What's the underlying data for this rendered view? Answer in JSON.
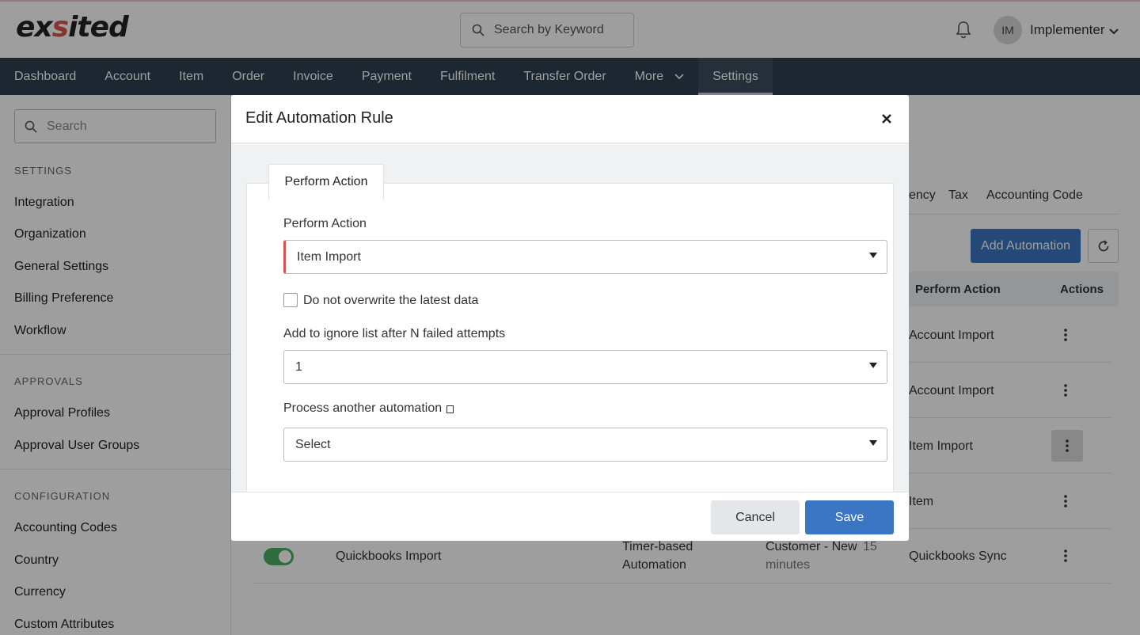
{
  "header": {
    "logo_text_a": "ex",
    "logo_text_b": "s",
    "logo_text_c": "ited",
    "search_placeholder": "Search by Keyword",
    "avatar_initials": "IM",
    "user_name": "Implementer"
  },
  "nav": {
    "items": [
      "Dashboard",
      "Account",
      "Item",
      "Order",
      "Invoice",
      "Payment",
      "Fulfilment",
      "Transfer Order",
      "More",
      "Settings"
    ],
    "active": "Settings"
  },
  "sidebar": {
    "search_placeholder": "Search",
    "settings_heading": "SETTINGS",
    "settings_items": [
      "Integration",
      "Organization",
      "General Settings",
      "Billing Preference",
      "Workflow"
    ],
    "approvals_heading": "APPROVALS",
    "approvals_items": [
      "Approval Profiles",
      "Approval User Groups"
    ],
    "configuration_heading": "CONFIGURATION",
    "configuration_items": [
      "Accounting Codes",
      "Country",
      "Currency",
      "Custom Attributes"
    ]
  },
  "main": {
    "tabs": [
      "ency",
      "Tax",
      "Accounting Code"
    ],
    "add_button": "Add Automation",
    "columns": {
      "perform_action": "Perform Action",
      "actions": "Actions"
    },
    "rows": [
      {
        "perform_action": "Account Import"
      },
      {
        "perform_action": "Account Import"
      },
      {
        "perform_action": "Item Import"
      },
      {
        "perform_action": "Item"
      },
      {
        "name": "Quickbooks Import",
        "type_line1": "Timer-based",
        "type_line2": "Automation",
        "trigger_line1": "Customer - New",
        "trigger_interval": "15",
        "trigger_line2": "minutes",
        "perform_action": "Quickbooks Sync"
      }
    ]
  },
  "modal": {
    "title": "Edit Automation Rule",
    "tab_label": "Perform Action",
    "perform_action_label": "Perform Action",
    "perform_action_value": "Item Import",
    "checkbox_label": "Do not overwrite the latest data",
    "ignore_label": "Add to ignore list after N failed attempts",
    "ignore_value": "1",
    "process_label": "Process another automation",
    "process_value": "Select",
    "cancel_label": "Cancel",
    "save_label": "Save"
  },
  "colors": {
    "nav_bg": "#2e3f50",
    "primary": "#3a76c4",
    "required": "#d9534f",
    "toggle_on": "#4caf63"
  }
}
